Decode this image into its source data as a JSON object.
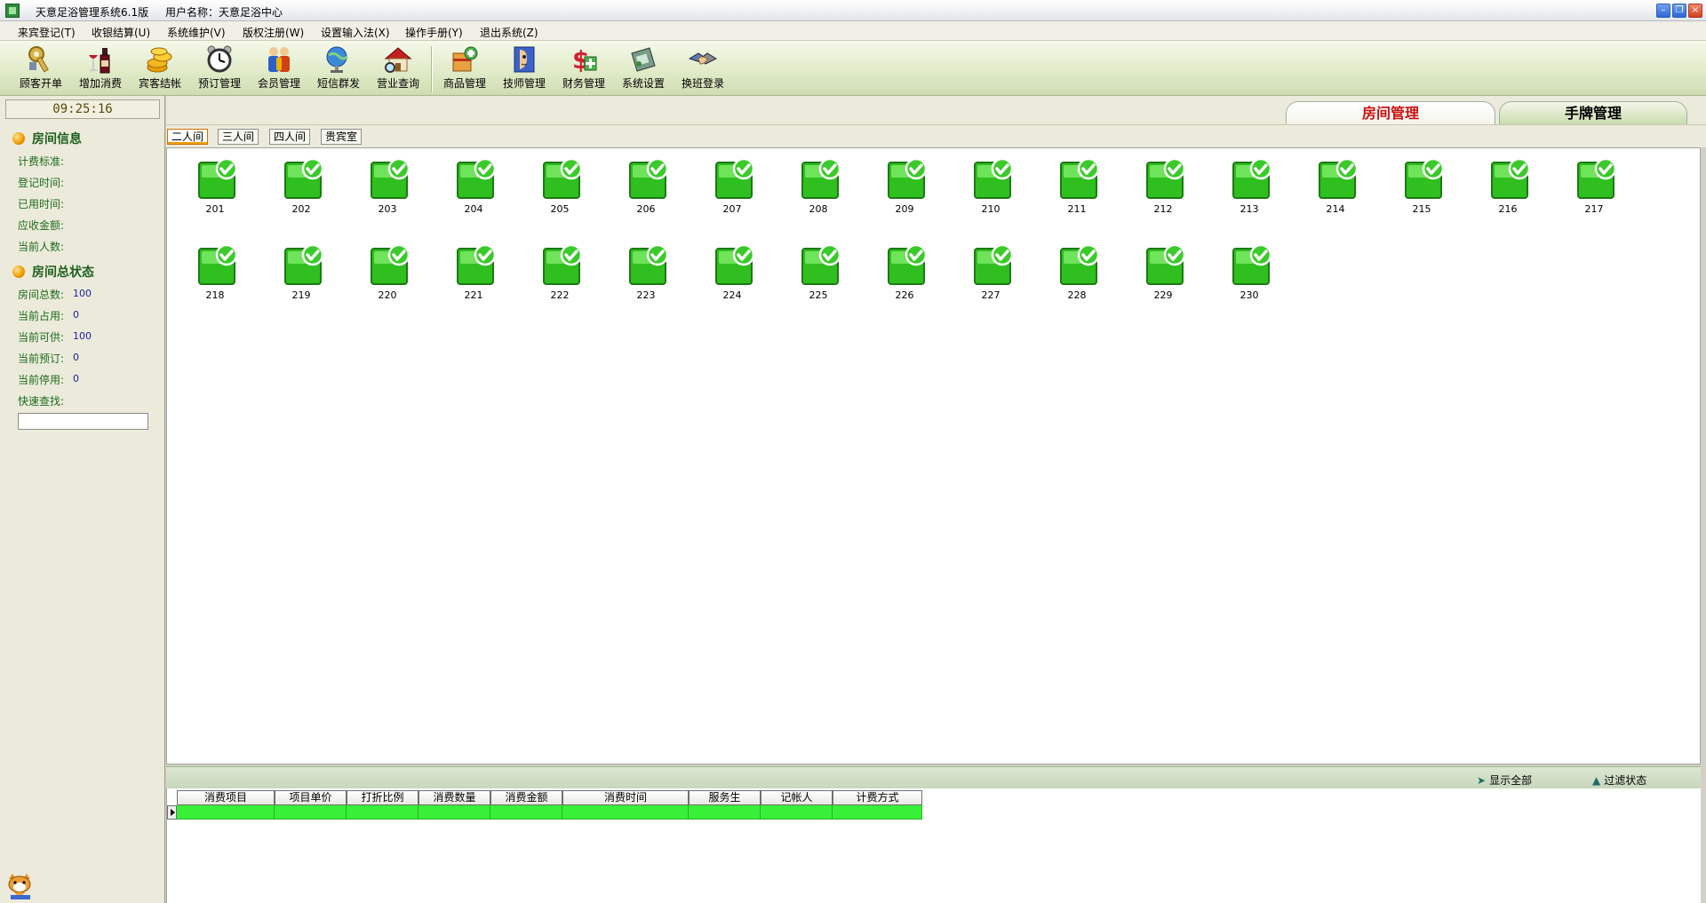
{
  "window": {
    "title": "天意足浴管理系统6.1版",
    "user_text": "用户名称：天意足浴中心"
  },
  "menu": [
    {
      "label": "来宾登记(T)"
    },
    {
      "label": "收银结算(U)"
    },
    {
      "label": "系统维护(V)"
    },
    {
      "label": "版权注册(W)"
    },
    {
      "label": "设置输入法(X)"
    },
    {
      "label": "操作手册(Y)"
    },
    {
      "label": "退出系统(Z)"
    }
  ],
  "toolbar": [
    {
      "label": "顾客开单",
      "icon": "key-icon"
    },
    {
      "label": "增加消费",
      "icon": "wine-icon"
    },
    {
      "label": "宾客结帐",
      "icon": "coins-icon"
    },
    {
      "label": "预订管理",
      "icon": "alarm-clock-icon"
    },
    {
      "label": "会员管理",
      "icon": "members-icon"
    },
    {
      "label": "短信群发",
      "icon": "satellite-icon"
    },
    {
      "label": "营业查询",
      "icon": "house-search-icon"
    },
    {
      "label": "商品管理",
      "icon": "goods-icon"
    },
    {
      "label": "技师管理",
      "icon": "technician-icon"
    },
    {
      "label": "财务管理",
      "icon": "finance-icon"
    },
    {
      "label": "系统设置",
      "icon": "settings-icon"
    },
    {
      "label": "换班登录",
      "icon": "handshake-icon"
    }
  ],
  "left_panel": {
    "clock": "09:25:16",
    "room_info_title": "房间信息",
    "room_info": [
      {
        "label": "计费标准:"
      },
      {
        "label": "登记时间:"
      },
      {
        "label": "已用时间:"
      },
      {
        "label": "应收金额:"
      },
      {
        "label": "当前人数:"
      }
    ],
    "status_title": "房间总状态",
    "status": [
      {
        "label": "房间总数:",
        "value": "100"
      },
      {
        "label": "当前占用:",
        "value": "0"
      },
      {
        "label": "当前可供:",
        "value": "100"
      },
      {
        "label": "当前预订:",
        "value": "0"
      },
      {
        "label": "当前停用:",
        "value": "0"
      }
    ],
    "quick_search_label": "快速查找:",
    "quick_search_value": ""
  },
  "main_tabs": [
    {
      "label": "房间管理",
      "active": true
    },
    {
      "label": "手牌管理",
      "active": false
    }
  ],
  "room_tabs": [
    {
      "label": "二人间",
      "active": true
    },
    {
      "label": "三人间",
      "active": false
    },
    {
      "label": "四人间",
      "active": false
    },
    {
      "label": "贵宾室",
      "active": false
    }
  ],
  "rooms": [
    "201",
    "202",
    "203",
    "204",
    "205",
    "206",
    "207",
    "208",
    "209",
    "210",
    "211",
    "212",
    "213",
    "214",
    "215",
    "216",
    "217",
    "218",
    "219",
    "220",
    "221",
    "222",
    "223",
    "224",
    "225",
    "226",
    "227",
    "228",
    "229",
    "230"
  ],
  "status_strip": {
    "show_all": "显示全部",
    "filter": "过滤状态"
  },
  "grid": {
    "columns": [
      "消费项目",
      "项目单价",
      "打折比例",
      "消费数量",
      "消费金额",
      "消费时间",
      "服务生",
      "记帐人",
      "计费方式"
    ]
  },
  "colors": {
    "room_available": "#2fbf1f",
    "active_tab_text": "#cc1111",
    "grid_row": "#38f038"
  }
}
